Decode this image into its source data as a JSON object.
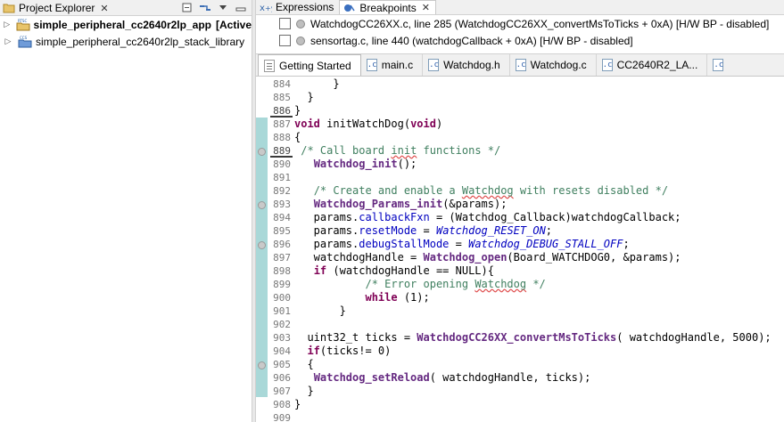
{
  "project_explorer": {
    "tab_label": "Project Explorer",
    "close": "✕",
    "projects": [
      {
        "name": "simple_peripheral_cc2640r2lp_app",
        "suffix": "[Active",
        "badge": "RTSC"
      },
      {
        "name": "simple_peripheral_cc2640r2lp_stack_library",
        "suffix": "",
        "badge": "CCS"
      }
    ]
  },
  "debug_views": {
    "tabs": [
      {
        "label": "Expressions",
        "close": ""
      },
      {
        "label": "Breakpoints",
        "close": "✕"
      }
    ],
    "breakpoints": [
      {
        "text": "WatchdogCC26XX.c, line 285 (WatchdogCC26XX_convertMsToTicks + 0xA)  [H/W BP - disabled]"
      },
      {
        "text": "sensortag.c, line 440 (watchdogCallback + 0xA)  [H/W BP - disabled]"
      }
    ]
  },
  "editor": {
    "tabs": [
      {
        "label": "Getting Started",
        "icon": "doc"
      },
      {
        "label": "main.c",
        "icon": "c"
      },
      {
        "label": "Watchdog.h",
        "icon": "c"
      },
      {
        "label": "Watchdog.c",
        "icon": "c"
      },
      {
        "label": "CC2640R2_LA...",
        "icon": "c"
      }
    ],
    "line_numbers": [
      "884",
      "885",
      "886",
      "887",
      "888",
      "889",
      "890",
      "891",
      "892",
      "893",
      "894",
      "895",
      "896",
      "897",
      "898",
      "899",
      "900",
      "901",
      "902",
      "903",
      "904",
      "905",
      "906",
      "907",
      "908",
      "909"
    ],
    "current_line_numbers": [
      "886",
      "889"
    ],
    "code_lines": [
      "      }",
      "  }",
      "}",
      "void initWatchDog(void)",
      "{",
      " /* Call board init functions */",
      "   Watchdog_init();",
      "",
      "   /* Create and enable a Watchdog with resets disabled */",
      "   Watchdog_Params_init(&params);",
      "   params.callbackFxn = (Watchdog_Callback)watchdogCallback;",
      "   params.resetMode = Watchdog_RESET_ON;",
      "   params.debugStallMode = Watchdog_DEBUG_STALL_OFF;",
      "   watchdogHandle = Watchdog_open(Board_WATCHDOG0, &params);",
      "   if (watchdogHandle == NULL){",
      "           /* Error opening Watchdog */",
      "           while (1);",
      "       }",
      "",
      "  uint32_t ticks = WatchdogCC26XX_convertMsToTicks( watchdogHandle, 5000);",
      "  if(ticks!= 0)",
      "  {",
      "   Watchdog_setReload( watchdogHandle, ticks);",
      "  }",
      "}",
      ""
    ]
  },
  "colors": {
    "keyword": "#7f0055",
    "function": "#642880",
    "enum_constant": "#0000c0",
    "comment": "#3f7f5f",
    "overview_fold": "#a9d8d8"
  }
}
